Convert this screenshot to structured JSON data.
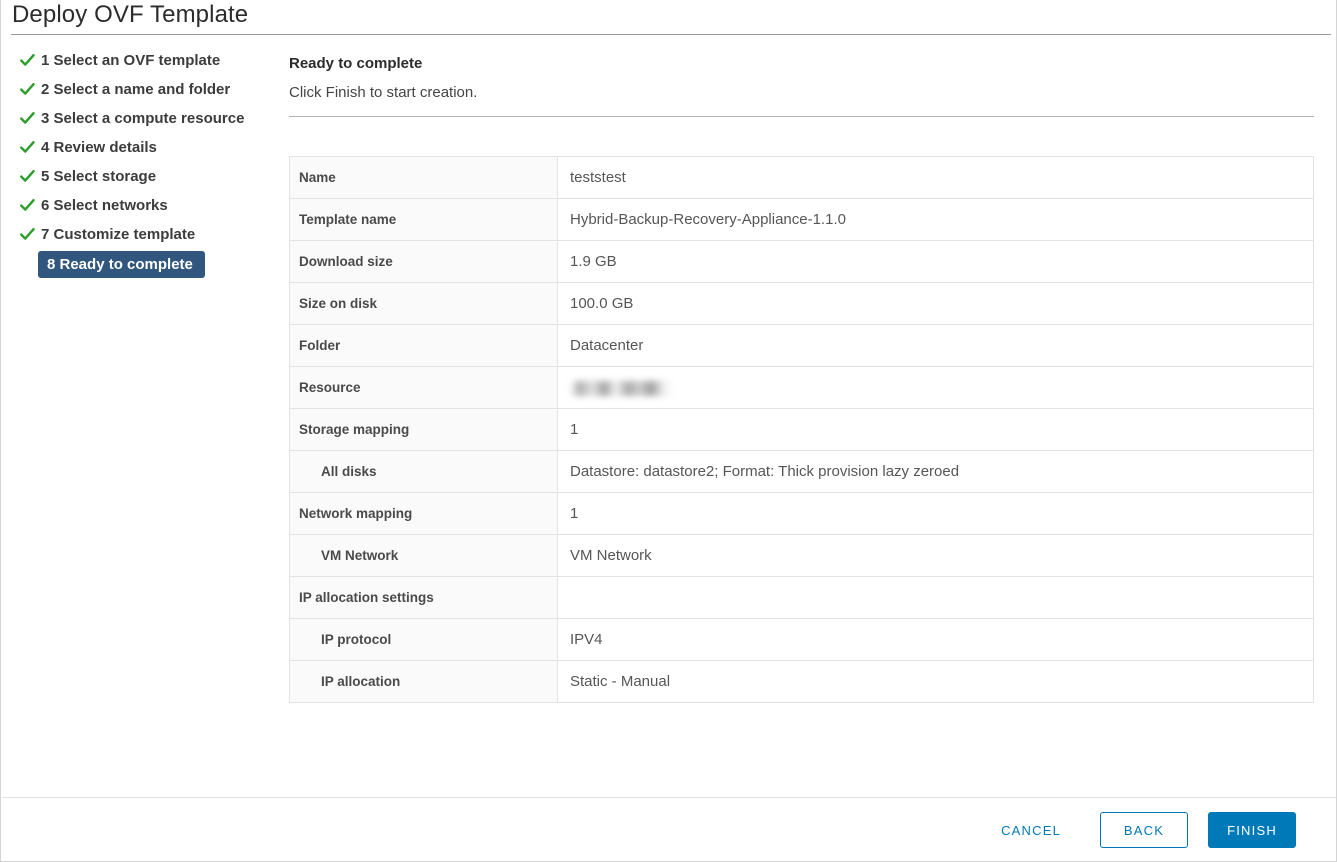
{
  "window": {
    "title": "Deploy OVF Template"
  },
  "steps": {
    "items": [
      {
        "label": "1 Select an OVF template",
        "state": "done",
        "icon": "check-icon"
      },
      {
        "label": "2 Select a name and folder",
        "state": "done",
        "icon": "check-icon"
      },
      {
        "label": "3 Select a compute resource",
        "state": "done",
        "icon": "check-icon"
      },
      {
        "label": "4 Review details",
        "state": "done",
        "icon": "check-icon"
      },
      {
        "label": "5 Select storage",
        "state": "done",
        "icon": "check-icon"
      },
      {
        "label": "6 Select networks",
        "state": "done",
        "icon": "check-icon"
      },
      {
        "label": "7 Customize template",
        "state": "done",
        "icon": "check-icon"
      },
      {
        "label": "8 Ready to complete",
        "state": "active",
        "icon": "none"
      }
    ]
  },
  "content": {
    "heading": "Ready to complete",
    "subheading": "Click Finish to start creation."
  },
  "summary": {
    "rows": [
      {
        "label": "Name",
        "value": "teststest",
        "indent": false,
        "redacted": false
      },
      {
        "label": "Template name",
        "value": "Hybrid-Backup-Recovery-Appliance-1.1.0",
        "indent": false,
        "redacted": false
      },
      {
        "label": "Download size",
        "value": "1.9 GB",
        "indent": false,
        "redacted": false
      },
      {
        "label": "Size on disk",
        "value": "100.0 GB",
        "indent": false,
        "redacted": false
      },
      {
        "label": "Folder",
        "value": "Datacenter",
        "indent": false,
        "redacted": false
      },
      {
        "label": "Resource",
        "value": "",
        "indent": false,
        "redacted": true
      },
      {
        "label": "Storage mapping",
        "value": "1",
        "indent": false,
        "redacted": false
      },
      {
        "label": "All disks",
        "value": "Datastore: datastore2; Format: Thick provision lazy zeroed",
        "indent": true,
        "redacted": false
      },
      {
        "label": "Network mapping",
        "value": "1",
        "indent": false,
        "redacted": false
      },
      {
        "label": "VM Network",
        "value": "VM Network",
        "indent": true,
        "redacted": false
      },
      {
        "label": "IP allocation settings",
        "value": "",
        "indent": false,
        "redacted": false
      },
      {
        "label": "IP protocol",
        "value": "IPV4",
        "indent": true,
        "redacted": false
      },
      {
        "label": "IP allocation",
        "value": "Static - Manual",
        "indent": true,
        "redacted": false
      }
    ]
  },
  "footer": {
    "cancel_label": "Cancel",
    "back_label": "Back",
    "finish_label": "Finish"
  },
  "colors": {
    "accent_blue": "#0079b8",
    "active_step_bg": "#31577e",
    "check_green": "#2d9e2d",
    "label_cell_bg": "#fafafa",
    "border": "#e3e3e3"
  }
}
